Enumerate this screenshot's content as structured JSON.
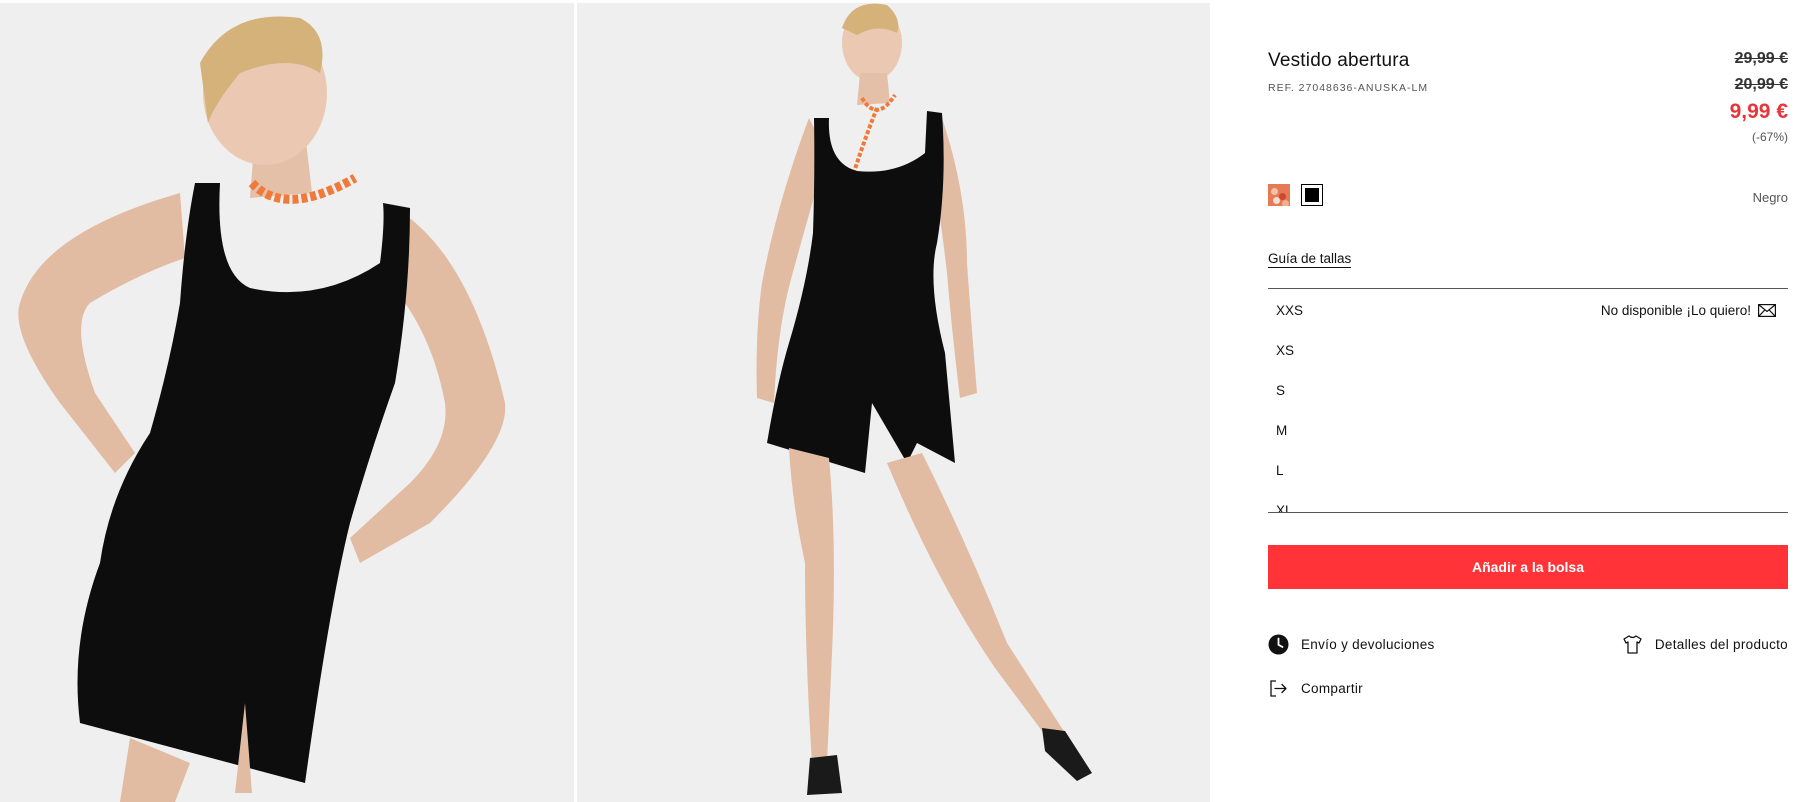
{
  "gallery": {
    "images": [
      {
        "alt": "Modelo con vestido negro, manos en la cintura"
      },
      {
        "alt": "Modelo de cuerpo entero con vestido negro"
      }
    ]
  },
  "product": {
    "title": "Vestido abertura",
    "ref": "REF. 27048636-ANUSKA-LM",
    "prices": {
      "original": "29,99 €",
      "previous": "20,99 €",
      "current": "9,99 €",
      "discount": "(-67%)"
    },
    "colors": {
      "options": [
        {
          "name": "estampado-icon",
          "swatch": "#e67a55"
        },
        {
          "name": "black-swatch-icon",
          "swatch": "#000000"
        }
      ],
      "selected_name": "Negro"
    },
    "size_guide_label": "Guía de tallas",
    "sizes": [
      {
        "label": "XXS",
        "status": "No disponible ¡Lo quiero!"
      },
      {
        "label": "XS",
        "status": ""
      },
      {
        "label": "S",
        "status": ""
      },
      {
        "label": "M",
        "status": ""
      },
      {
        "label": "L",
        "status": ""
      },
      {
        "label": "XL",
        "status": ""
      }
    ],
    "add_to_bag_label": "Añadir a la bolsa",
    "links": {
      "shipping": "Envío y devoluciones",
      "details": "Detalles del producto",
      "share": "Compartir"
    }
  },
  "colors": {
    "accent": "#ff3338",
    "sale": "#e8343b",
    "text": "#111111"
  }
}
